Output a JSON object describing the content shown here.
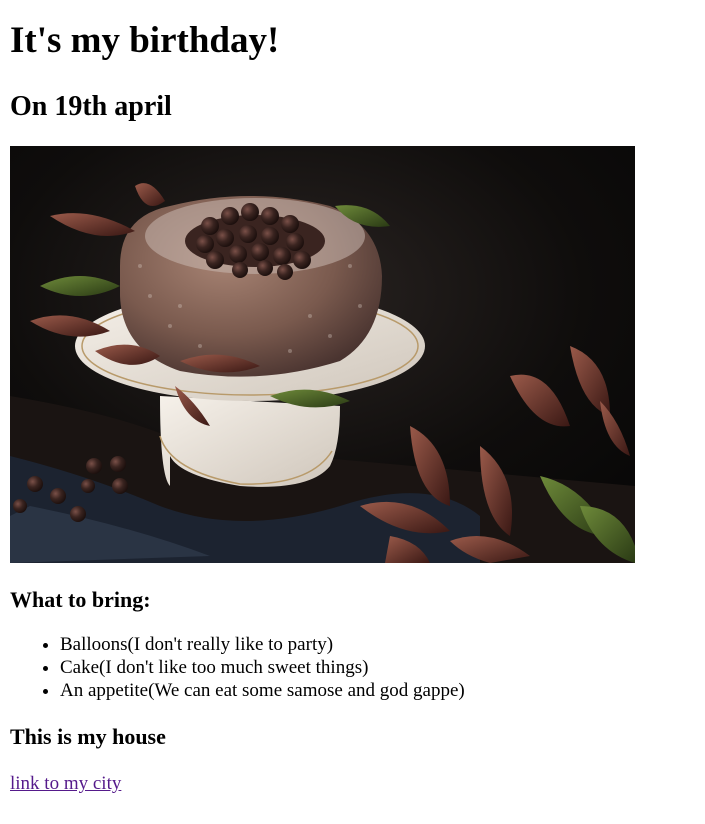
{
  "page": {
    "heading": "It's my birthday!",
    "subheading": "On 19th april",
    "image": {
      "alt": "Chocolate bundt cake on a cake stand",
      "colors": {
        "background": "#0b0a0a",
        "cake": "#7a5a4e",
        "sugar": "#c9b8b0",
        "balls": "#3a2420",
        "plate": "#efe8df",
        "plate_edge": "#b89a6a",
        "cloth": "#1c2330",
        "leaf_dark": "#5a2a24",
        "leaf_light": "#8a4a3a",
        "leaf_green": "#3e5a24"
      }
    },
    "bring_heading": "What to bring:",
    "bring_items": [
      "Balloons(I don't really like to party)",
      "Cake(I don't like too much sweet things)",
      "An appetite(We can eat some samose and god gappe)"
    ],
    "house_heading": "This is my house",
    "city_link": "link to my city"
  }
}
